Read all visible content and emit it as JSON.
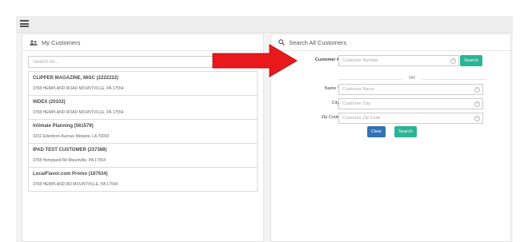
{
  "toolbar": {
    "menu_icon": "hamburger-icon"
  },
  "left_panel": {
    "title": "My Customers",
    "icon": "users-icon",
    "search_placeholder": "Search for...",
    "customers": [
      {
        "name": "CLIPPER MAGAZINE, MISC (2222222)",
        "address": "3708 HEMPLAND ROAD MOUNTVILLE, PA 17554"
      },
      {
        "name": "INDEX (20102)",
        "address": "3708 HEMPLAND ROAD MOUNTVILLE, PA 17554"
      },
      {
        "name": "Intimate Planning (561579)",
        "address": "3232 Edenborn Avenue Metairie, LA 70002"
      },
      {
        "name": "IPAD TEST CUSTOMER (237388)",
        "address": "3708 Hempland Rd Mountville, PA 17554"
      },
      {
        "name": "LocalFlavor.com Promo (187634)",
        "address": "3708 HEMPLAND RD MOUNTVILLE, PA 17554"
      }
    ]
  },
  "right_panel": {
    "title": "Search All Customers",
    "icon": "search-icon",
    "customer_number": {
      "label": "Customer #",
      "placeholder": "Customer Number"
    },
    "search_button_top": "Search",
    "or_text": "OR",
    "name": {
      "label": "Name *",
      "placeholder": "Customer Name"
    },
    "city": {
      "label": "City",
      "placeholder": "Customer City"
    },
    "zip": {
      "label": "Zip Code",
      "placeholder": "Customer Zip Code"
    },
    "clear_button": "Clear",
    "search_button_bottom": "Search"
  },
  "annotation": {
    "arrow_color": "#e8181c"
  },
  "colors": {
    "teal": "#2bb596",
    "blue": "#3373b5"
  }
}
